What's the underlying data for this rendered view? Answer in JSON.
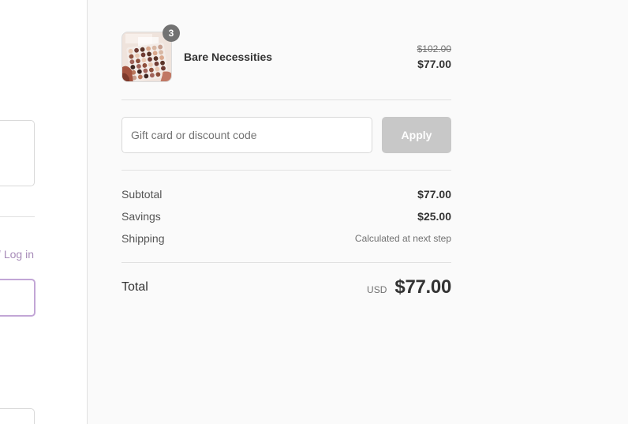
{
  "left_pane": {
    "login_prefix": "/",
    "login_link": "Log in"
  },
  "product": {
    "name": "Bare Necessities",
    "quantity": "3",
    "original_price": "$102.00",
    "price": "$77.00",
    "thumbnail": "eyeshadow-palette-image"
  },
  "discount": {
    "placeholder": "Gift card or discount code",
    "value": "",
    "apply_label": "Apply"
  },
  "summary_lines": {
    "subtotal_label": "Subtotal",
    "subtotal_value": "$77.00",
    "savings_label": "Savings",
    "savings_value": "$25.00",
    "shipping_label": "Shipping",
    "shipping_value": "Calculated at next step"
  },
  "total": {
    "label": "Total",
    "currency": "USD",
    "amount": "$77.00"
  },
  "colors": {
    "accent_link": "#a78bb8",
    "accent_border": "#c2a6d6",
    "button_disabled": "#c8c8c8",
    "badge": "#727272"
  }
}
